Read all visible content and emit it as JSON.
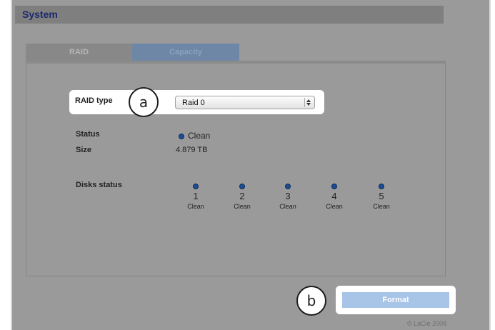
{
  "header": {
    "title": "System"
  },
  "tabs": [
    {
      "label": "RAID"
    },
    {
      "label": "Capacity"
    }
  ],
  "raid_type": {
    "label": "RAID type",
    "selected": "Raid 0"
  },
  "status": {
    "label": "Status",
    "value": "Clean",
    "indicator_color": "#1a4e97"
  },
  "size": {
    "label": "Size",
    "value": "4.879 TB"
  },
  "disks_status": {
    "label": "Disks status",
    "disks": [
      {
        "number": "1",
        "status": "Clean"
      },
      {
        "number": "2",
        "status": "Clean"
      },
      {
        "number": "3",
        "status": "Clean"
      },
      {
        "number": "4",
        "status": "Clean"
      },
      {
        "number": "5",
        "status": "Clean"
      }
    ]
  },
  "callouts": {
    "a": "a",
    "b": "b"
  },
  "format_button": {
    "label": "Format"
  },
  "footer": {
    "copyright": "© LaCie 2008"
  }
}
